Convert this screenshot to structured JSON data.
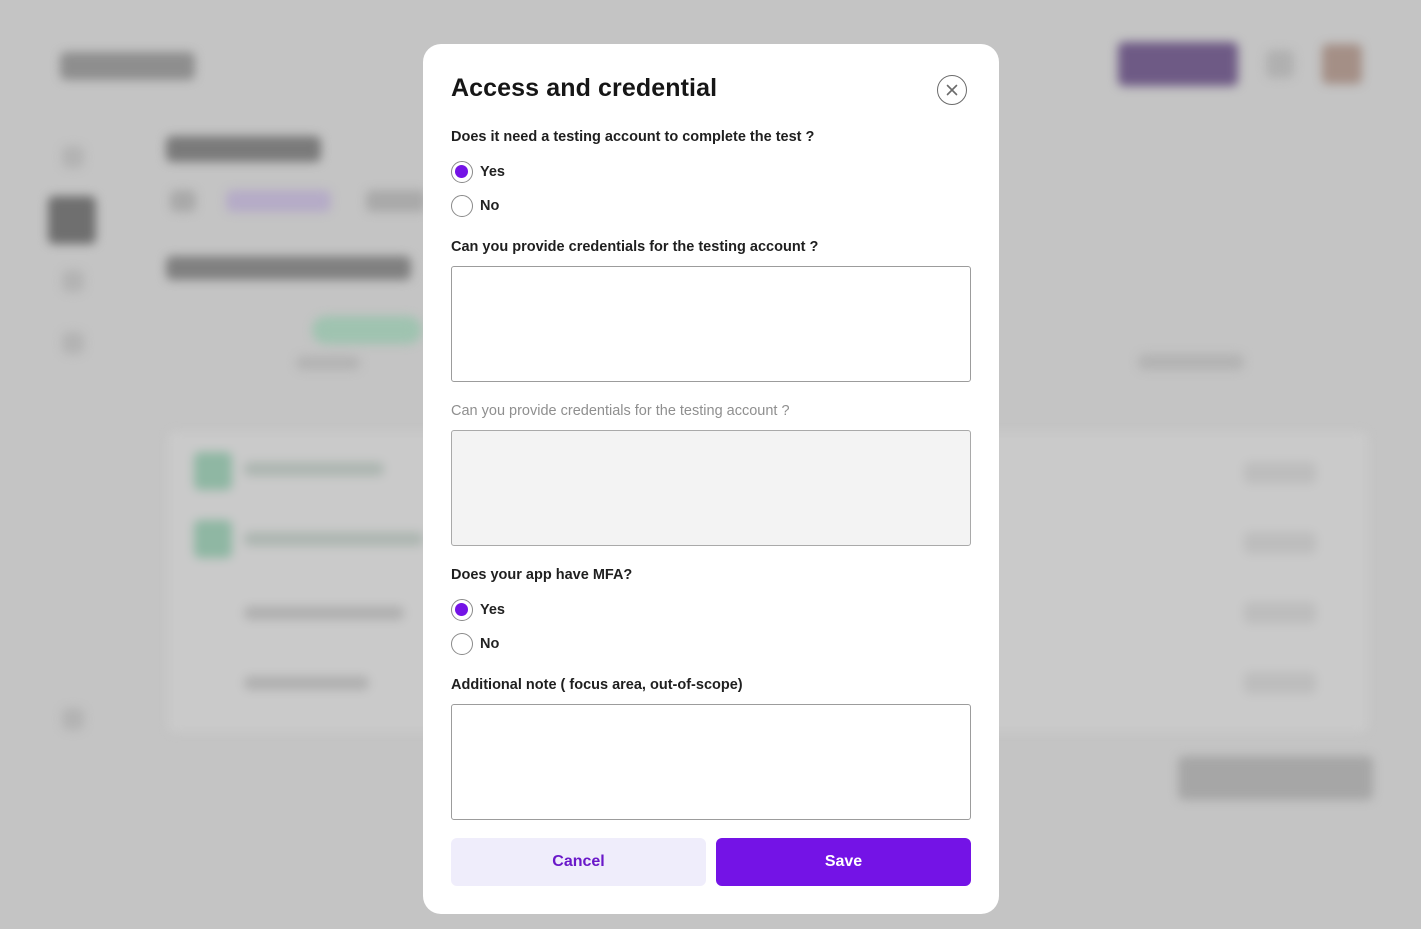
{
  "modal": {
    "title": "Access and credential",
    "close_icon": "close-icon",
    "questions": {
      "testing_account": {
        "label": "Does it need a testing account to complete the test ?",
        "options": [
          {
            "label": "Yes",
            "checked": true
          },
          {
            "label": "No",
            "checked": false
          }
        ]
      },
      "credentials": {
        "label": "Can you provide credentials for the testing account ?",
        "value": ""
      },
      "credentials_disabled": {
        "label": "Can you provide credentials for the testing account ?",
        "value": ""
      },
      "mfa": {
        "label": "Does your app have MFA?",
        "options": [
          {
            "label": "Yes",
            "checked": true
          },
          {
            "label": "No",
            "checked": false
          }
        ]
      },
      "additional_note": {
        "label": "Additional note ( focus area, out-of-scope)",
        "value": ""
      }
    },
    "buttons": {
      "cancel": "Cancel",
      "save": "Save"
    }
  },
  "colors": {
    "accent": "#7413E6",
    "cancel_bg": "#EFEDFB",
    "overlay": "#C4C4C4"
  }
}
